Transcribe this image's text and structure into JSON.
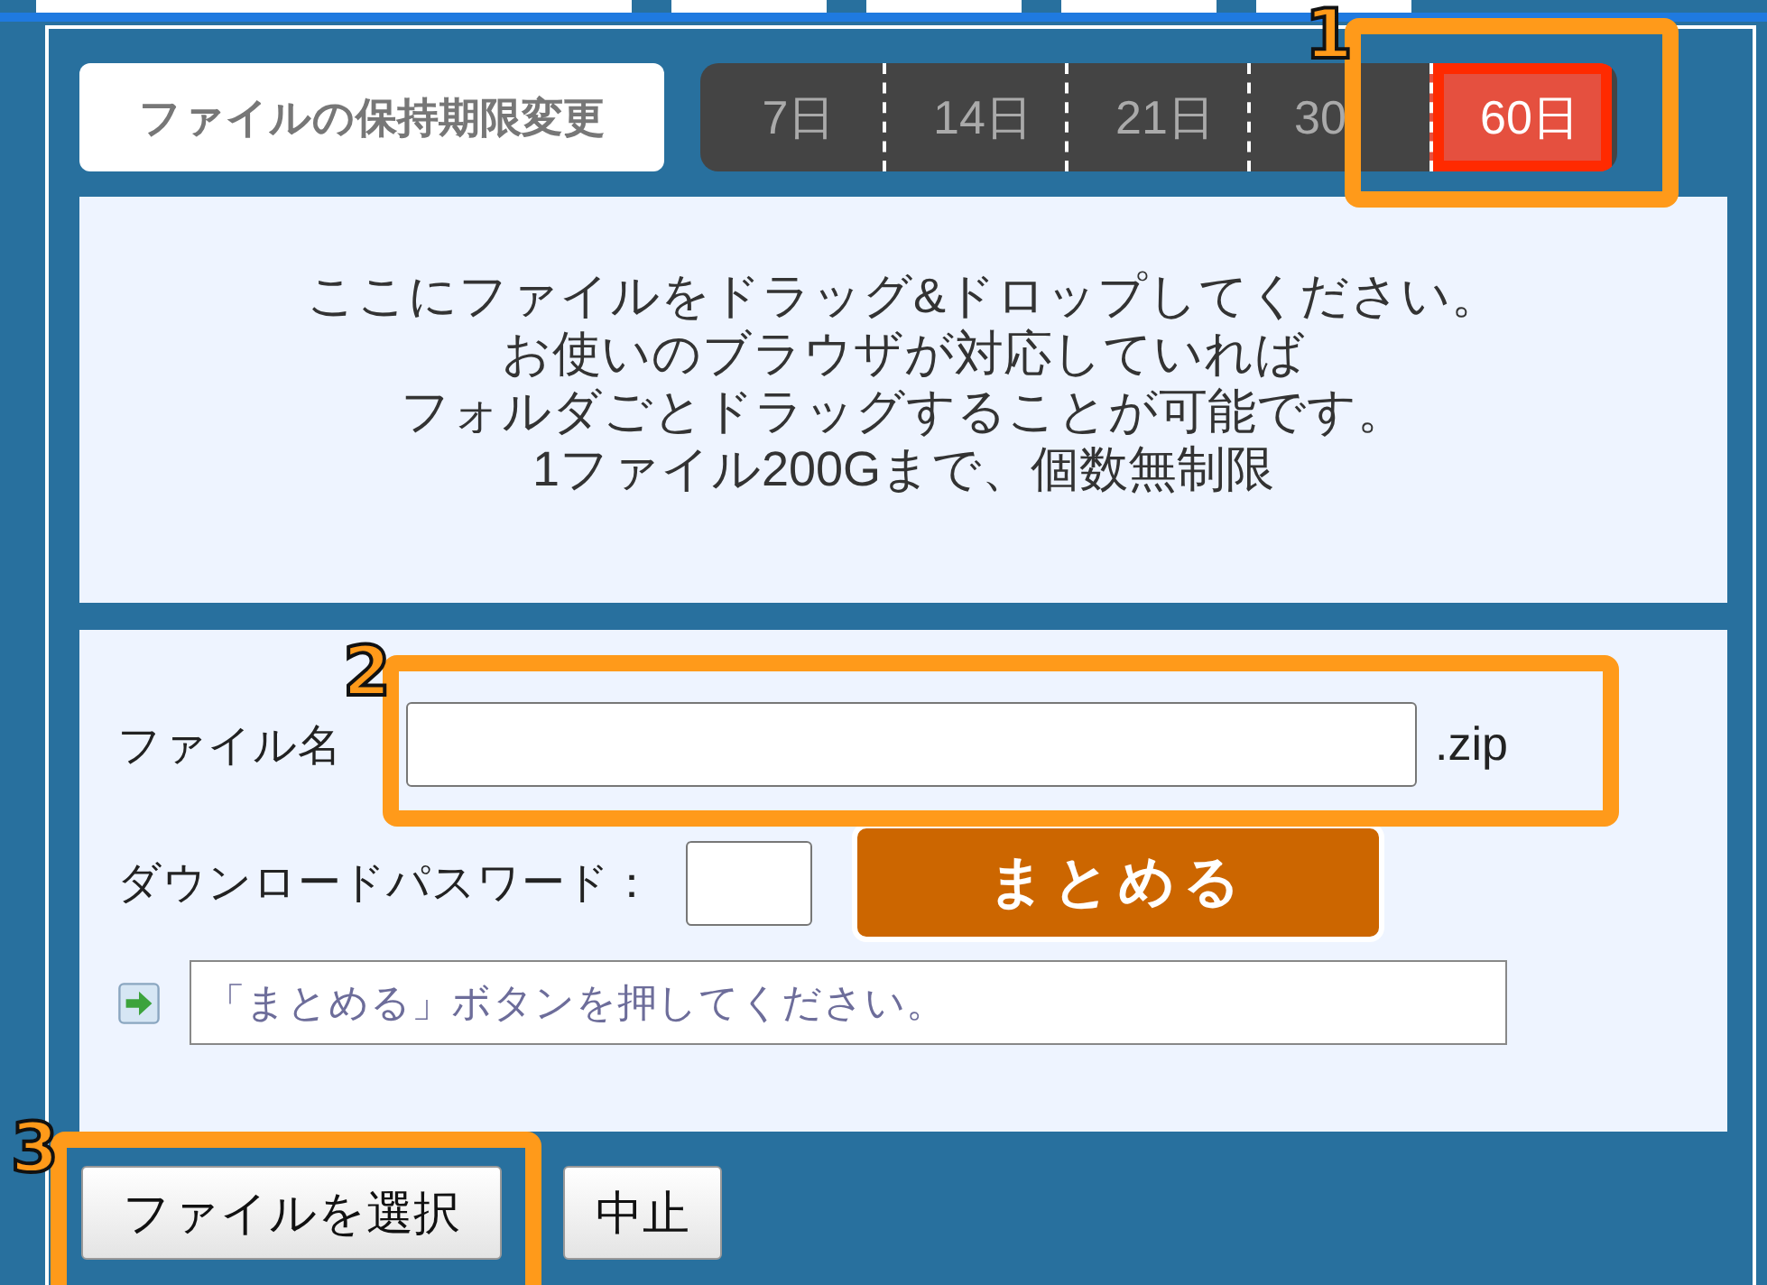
{
  "retention": {
    "label": "ファイルの保持期限変更",
    "options": [
      {
        "label": "7日",
        "selected": false
      },
      {
        "label": "14日",
        "selected": false
      },
      {
        "label": "21日",
        "selected": false
      },
      {
        "label": "30",
        "selected": false
      },
      {
        "label": "60日",
        "selected": true
      }
    ]
  },
  "drop_zone": {
    "lines": [
      "ここにファイルをドラッグ&ドロップしてください。",
      "お使いのブラウザが対応していれば",
      "フォルダごとドラッグすることが可能です。",
      "1ファイル200Gまで、個数無制限"
    ]
  },
  "form": {
    "filename_label": "ファイル名",
    "extension": ".zip",
    "password_label": "ダウンロードパスワード：",
    "submit": "まとめる",
    "status": "「まとめる」ボタンを押してください。"
  },
  "buttons": [
    {
      "label": "ファイルを選択",
      "kind": "choose"
    },
    {
      "label": "中止",
      "kind": "cancel"
    }
  ],
  "callouts": [
    {
      "number": "1",
      "kind": "retention"
    },
    {
      "number": "2",
      "kind": "filename"
    },
    {
      "number": "3",
      "kind": "choose"
    }
  ]
}
